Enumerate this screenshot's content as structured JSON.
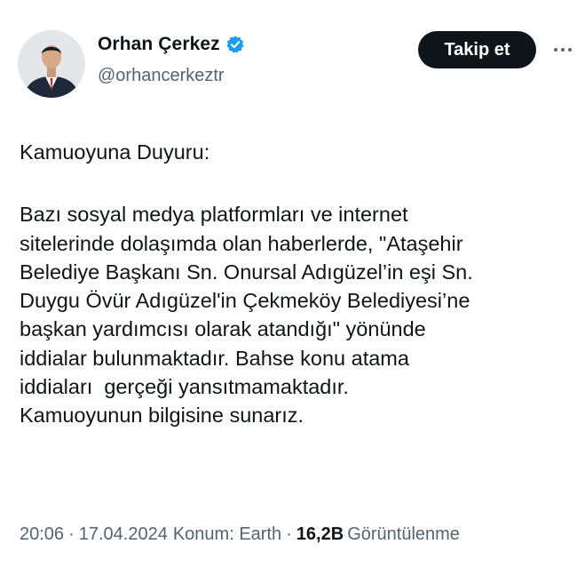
{
  "author": {
    "name": "Orhan Çerkez",
    "handle": "@orhancerkeztr",
    "verified_color": "#1d9bf0"
  },
  "actions": {
    "follow_label": "Takip et",
    "more_icon": "more-horizontal-icon"
  },
  "tweet": {
    "heading": "Kamuoyuna Duyuru:",
    "lines": [
      "Bazı sosyal medya platformları ve internet",
      "sitelerinde dolaşımda olan haberlerde, \"Ataşehir",
      "Belediye Başkanı Sn. Onursal Adıgüzel’in eşi Sn.",
      "Duygu Övür Adıgüzel'in Çekmeköy Belediyesi’ne",
      "başkan yardımcısı olarak atandığı\" yönünde",
      "iddialar bulunmaktadır. Bahse konu atama",
      "iddiaları  gerçeği yansıtmamaktadır.",
      "Kamuoyunun bilgisine sunarız."
    ]
  },
  "meta": {
    "time": "20:06",
    "separator": "·",
    "date": "17.04.2024",
    "location": "Konum: Earth",
    "views_count": "16,2B",
    "views_label": "Görüntülenme"
  },
  "colors": {
    "text": "#0f1419",
    "secondary": "#536471",
    "button_bg": "#0f1419",
    "button_text": "#ffffff"
  }
}
